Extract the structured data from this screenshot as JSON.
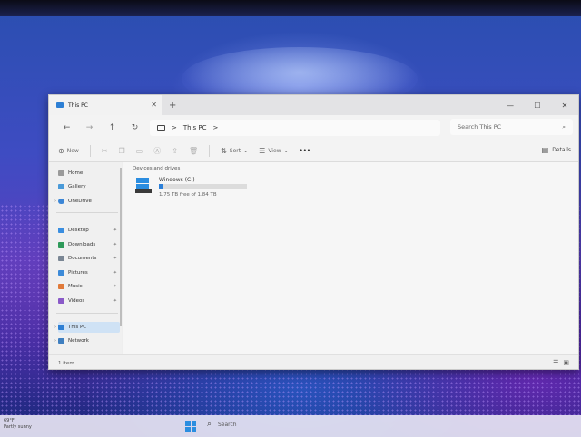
{
  "colors": {
    "accent": "#2b7fd8",
    "window_bg": "#eeeeee",
    "selected": "#cfe2f5"
  },
  "window": {
    "tab_title": "This PC",
    "new_tab": "+",
    "controls": {
      "minimize": "—",
      "maximize": "☐",
      "close": "✕"
    }
  },
  "nav": {
    "back": "←",
    "forward": "→",
    "up": "↑",
    "refresh": "↻",
    "address_sep1": ">",
    "address": "This PC",
    "address_sep2": ">",
    "search_placeholder": "Search This PC"
  },
  "toolbar": {
    "new_label": "New",
    "sort_label": "Sort",
    "view_label": "View",
    "more_label": "•••",
    "details_label": "Details"
  },
  "sidebar": {
    "items": [
      {
        "label": "Home",
        "icon": "home-icon"
      },
      {
        "label": "Gallery",
        "icon": "gallery-icon"
      },
      {
        "label": "OneDrive",
        "icon": "onedrive-icon"
      },
      {
        "label": "Desktop",
        "icon": "folder-icon"
      },
      {
        "label": "Downloads",
        "icon": "download-icon"
      },
      {
        "label": "Documents",
        "icon": "document-icon"
      },
      {
        "label": "Pictures",
        "icon": "picture-icon"
      },
      {
        "label": "Music",
        "icon": "music-icon"
      },
      {
        "label": "Videos",
        "icon": "video-icon"
      },
      {
        "label": "This PC",
        "icon": "pc-icon"
      },
      {
        "label": "Network",
        "icon": "network-icon"
      }
    ]
  },
  "content": {
    "section_title": "Devices and drives",
    "drive": {
      "name": "Windows (C:)",
      "space": "1.75 TB free of 1.84 TB",
      "used_fraction": 0.05
    }
  },
  "status": {
    "items": "1 item"
  },
  "taskbar": {
    "temperature": "69°F",
    "weather": "Partly sunny",
    "search_label": "Search"
  }
}
